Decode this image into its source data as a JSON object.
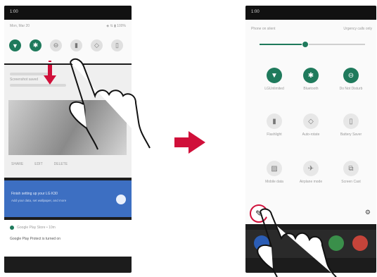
{
  "left": {
    "status_time": "1:00",
    "header_text": "Mon, Mar 20",
    "status_icons": "◈ ⇅ ▮ 100%",
    "quick_tiles": [
      {
        "icon": "wifi-icon",
        "glyph": "▼",
        "on": true
      },
      {
        "icon": "bluetooth-icon",
        "glyph": "✱",
        "on": true
      },
      {
        "icon": "do-not-disturb-icon",
        "glyph": "⊖",
        "on": false
      },
      {
        "icon": "flashlight-icon",
        "glyph": "▮",
        "on": false
      },
      {
        "icon": "auto-rotate-icon",
        "glyph": "◇",
        "on": false
      },
      {
        "icon": "battery-saver-icon",
        "glyph": "▯",
        "on": false
      }
    ],
    "notification_title": "Screenshot saved",
    "actions": [
      "SHARE",
      "EDIT",
      "DELETE"
    ],
    "setup_card_title": "Finish setting up your LG K30",
    "setup_card_text": "Add your data, set wallpaper, and more",
    "play_app": "Google Play Store • 10m",
    "play_text": "Google Play Protect is turned on"
  },
  "right": {
    "status_time": "1:00",
    "header_text": "Phone on silent",
    "header_right": "Urgency calls only",
    "tiles": [
      {
        "name": "wifi",
        "glyph": "▼",
        "on": true,
        "label": "LGUnlimited"
      },
      {
        "name": "bluetooth",
        "glyph": "✱",
        "on": true,
        "label": "Bluetooth"
      },
      {
        "name": "do-not-disturb",
        "glyph": "⊖",
        "on": true,
        "label": "Do Not Disturb"
      },
      {
        "name": "flashlight",
        "glyph": "▮",
        "on": false,
        "label": "Flashlight"
      },
      {
        "name": "auto-rotate",
        "glyph": "◇",
        "on": false,
        "label": "Auto-rotate"
      },
      {
        "name": "battery-saver",
        "glyph": "▯",
        "on": false,
        "label": "Battery Saver"
      },
      {
        "name": "mobile-data",
        "glyph": "▨",
        "on": false,
        "label": "Mobile data"
      },
      {
        "name": "airplane-mode",
        "glyph": "✈",
        "on": false,
        "label": "Airplane mode"
      },
      {
        "name": "screen-cast",
        "glyph": "⧉",
        "on": false,
        "label": "Screen Cast"
      }
    ],
    "edit_glyph": "✎",
    "settings_glyph": "⚙"
  },
  "colors": {
    "accent": "#1f7a5c",
    "arrow": "#d0103a",
    "blue_card": "#3d6fc2"
  }
}
